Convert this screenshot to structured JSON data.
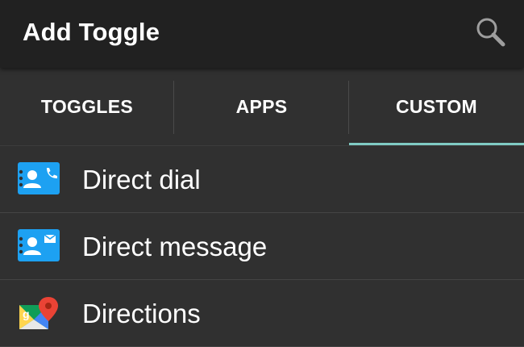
{
  "appbar": {
    "title": "Add Toggle",
    "search_icon": "search-icon"
  },
  "tabs": [
    {
      "label": "TOGGLES",
      "selected": false
    },
    {
      "label": "APPS",
      "selected": false
    },
    {
      "label": "CUSTOM",
      "selected": true
    }
  ],
  "list": {
    "items": [
      {
        "label": "Direct dial",
        "icon": "contact-call-icon"
      },
      {
        "label": "Direct message",
        "icon": "contact-message-icon"
      },
      {
        "label": "Directions",
        "icon": "maps-icon"
      }
    ]
  },
  "colors": {
    "appbar_bg": "#212121",
    "content_bg": "#303030",
    "tab_indicator": "#80cbc4",
    "contact_icon_blue": "#1da1f2"
  }
}
